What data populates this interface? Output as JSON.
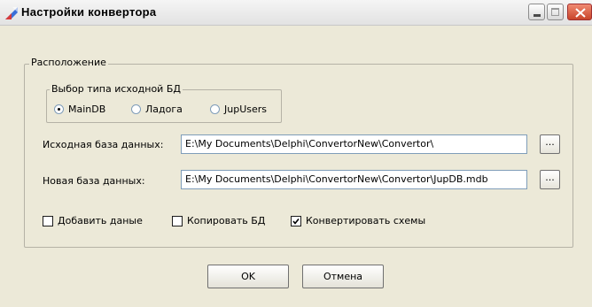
{
  "window": {
    "title": "Настройки конвертора",
    "icon": "converter-app-icon"
  },
  "location_group": {
    "legend": "Расположение",
    "db_type_group": {
      "legend": "Выбор типа исходной БД",
      "options": [
        {
          "label": "MainDB",
          "checked": true
        },
        {
          "label": "Ладога",
          "checked": false
        },
        {
          "label": "JupUsers",
          "checked": false
        }
      ]
    },
    "source_db": {
      "label": "Исходная база данных:",
      "value": "E:\\My Documents\\Delphi\\ConvertorNew\\Convertor\\",
      "browse": "..."
    },
    "new_db": {
      "label": "Новая база данных:",
      "value": "E:\\My Documents\\Delphi\\ConvertorNew\\Convertor\\JupDB.mdb",
      "browse": "..."
    },
    "options": [
      {
        "label": "Добавить даные",
        "checked": false
      },
      {
        "label": "Копировать БД",
        "checked": false
      },
      {
        "label": "Конвертировать схемы",
        "checked": true
      }
    ]
  },
  "buttons": {
    "ok": "OK",
    "cancel": "Отмена"
  }
}
